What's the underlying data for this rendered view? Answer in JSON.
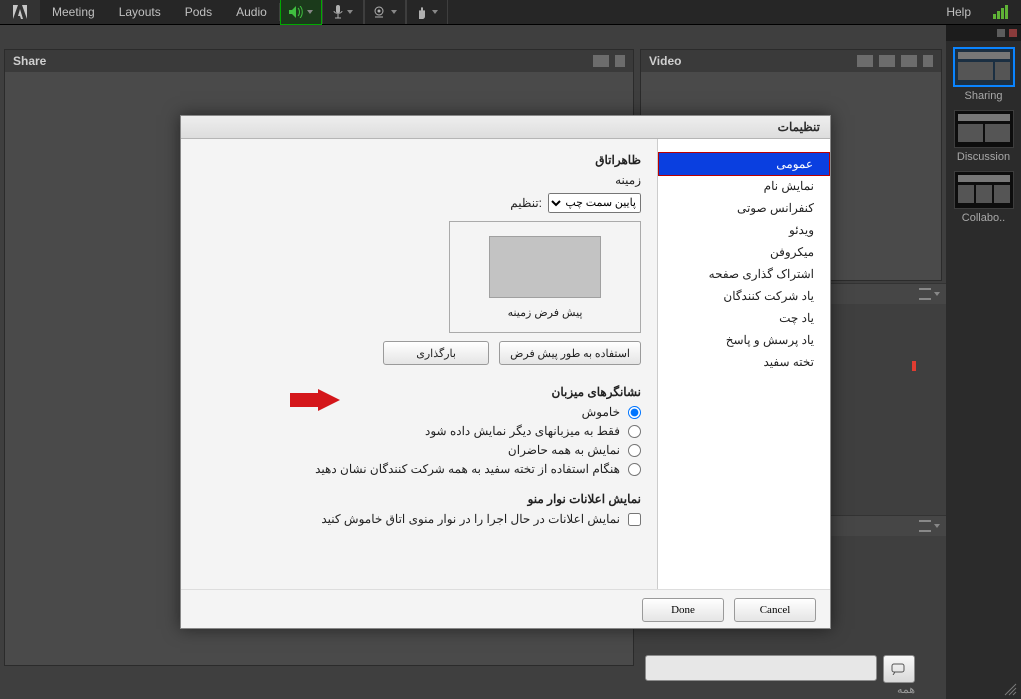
{
  "topbar": {
    "menu": [
      "Meeting",
      "Layouts",
      "Pods",
      "Audio"
    ],
    "help": "Help"
  },
  "pods": {
    "share_title": "Share",
    "video_title": "Video"
  },
  "rside": {
    "items": [
      {
        "label": "Sharing"
      },
      {
        "label": "Discussion"
      },
      {
        "label": "Collabo.."
      }
    ]
  },
  "dialog": {
    "title": "تنظیمات",
    "sidebar": [
      "عمومی",
      "نمایش نام",
      "کنفرانس صوتی",
      "ویدئو",
      "میکروفن",
      "اشتراک گذاری صفحه",
      "یاد شرکت کنندگان",
      "یاد چت",
      "یاد پرسش و پاسخ",
      "تخته سفید"
    ],
    "appearance_heading": "ظاهراتاق",
    "background_label": "زمینه",
    "adjust_label": ":تنظیم",
    "dropdown_value": "پایین سمت چپ",
    "preview_caption": "پیش فرض زمینه",
    "btn_use_default": "استفاده به طور پیش فرض",
    "btn_upload": "بارگذاری",
    "cursors_heading": "نشانگرهای میزبان",
    "cursors_options": [
      "خاموش",
      "فقط به میزبانهای دیگر نمایش داده شود",
      "نمایش به همه حاضران",
      "هنگام استفاده از تخته سفید به همه شرکت کنندگان نشان دهید"
    ],
    "menubar_heading": "نمایش اعلانات نوار منو",
    "menubar_checkbox": "نمایش اعلانات در حال اجرا را در نوار منوی اتاق خاموش کنید",
    "done": "Done",
    "cancel": "Cancel"
  },
  "foot_label": "همه"
}
